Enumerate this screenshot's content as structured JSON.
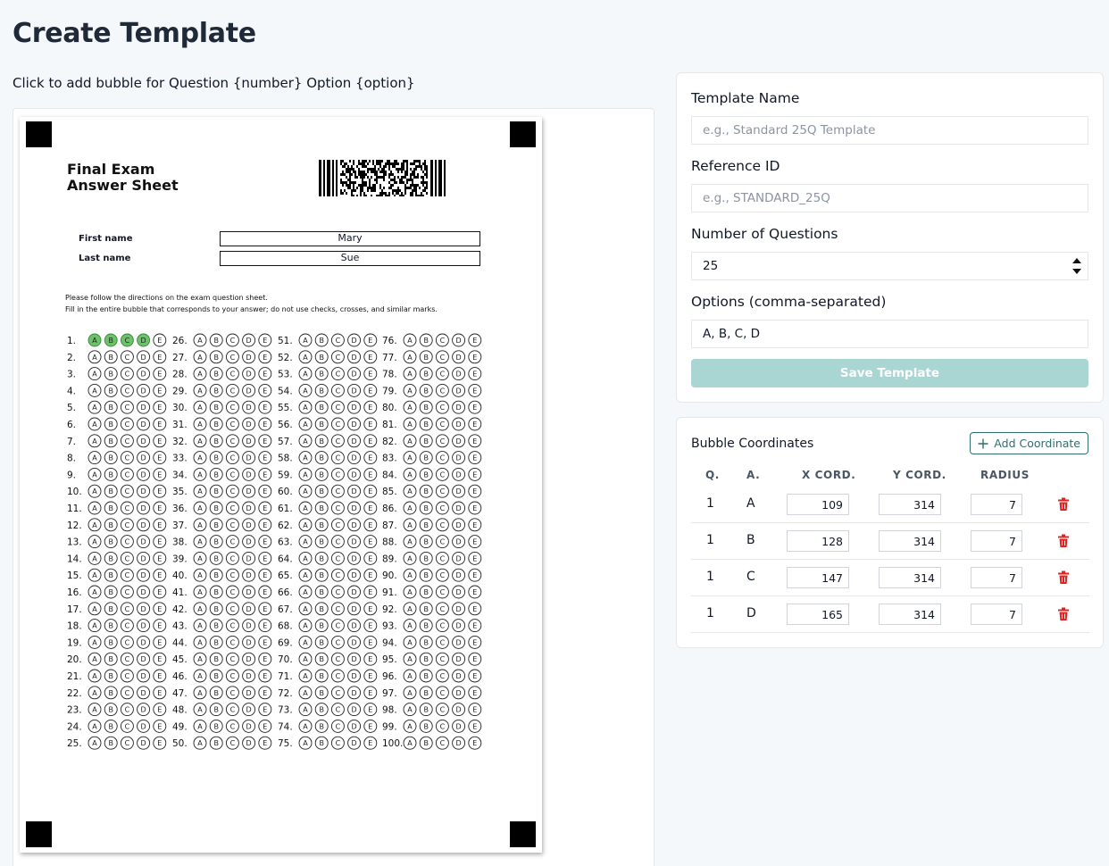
{
  "page": {
    "title": "Create Template",
    "instruction": "Click to add bubble for Question {number} Option {option}"
  },
  "sheet": {
    "title_line1": "Final Exam",
    "title_line2": "Answer Sheet",
    "first_name_label": "First name",
    "last_name_label": "Last name",
    "first_name_value": "Mary",
    "last_name_value": "Sue",
    "directions_line1": "Please follow the directions on the exam question sheet.",
    "directions_line2": "Fill in the entire bubble that corresponds to your answer; do not use checks, crosses, and similar marks.",
    "question_count": 100,
    "bubble_options": [
      "A",
      "B",
      "C",
      "D",
      "E"
    ],
    "highlighted_question": 1,
    "highlighted_options": [
      "A",
      "B",
      "C",
      "D"
    ],
    "highlight_color": "#6cc26a"
  },
  "form": {
    "template_name_label": "Template Name",
    "template_name_placeholder": "e.g., Standard 25Q Template",
    "template_name_value": "",
    "reference_id_label": "Reference ID",
    "reference_id_placeholder": "e.g., STANDARD_25Q",
    "reference_id_value": "",
    "num_questions_label": "Number of Questions",
    "num_questions_value": "25",
    "options_label": "Options (comma-separated)",
    "options_value": "A, B, C, D",
    "save_label": "Save Template"
  },
  "coords": {
    "title": "Bubble Coordinates",
    "add_label": "Add Coordinate",
    "headers": {
      "q": "Q.",
      "a": "A.",
      "x": "X CORD.",
      "y": "Y CORD.",
      "r": "RADIUS"
    },
    "rows": [
      {
        "q": "1",
        "a": "A",
        "x": "109",
        "y": "314",
        "r": "7"
      },
      {
        "q": "1",
        "a": "B",
        "x": "128",
        "y": "314",
        "r": "7"
      },
      {
        "q": "1",
        "a": "C",
        "x": "147",
        "y": "314",
        "r": "7"
      },
      {
        "q": "1",
        "a": "D",
        "x": "165",
        "y": "314",
        "r": "7"
      }
    ]
  },
  "colors": {
    "accent": "#2f6e6e",
    "save_button": "#a9d5d3",
    "trash": "#dc2626"
  }
}
